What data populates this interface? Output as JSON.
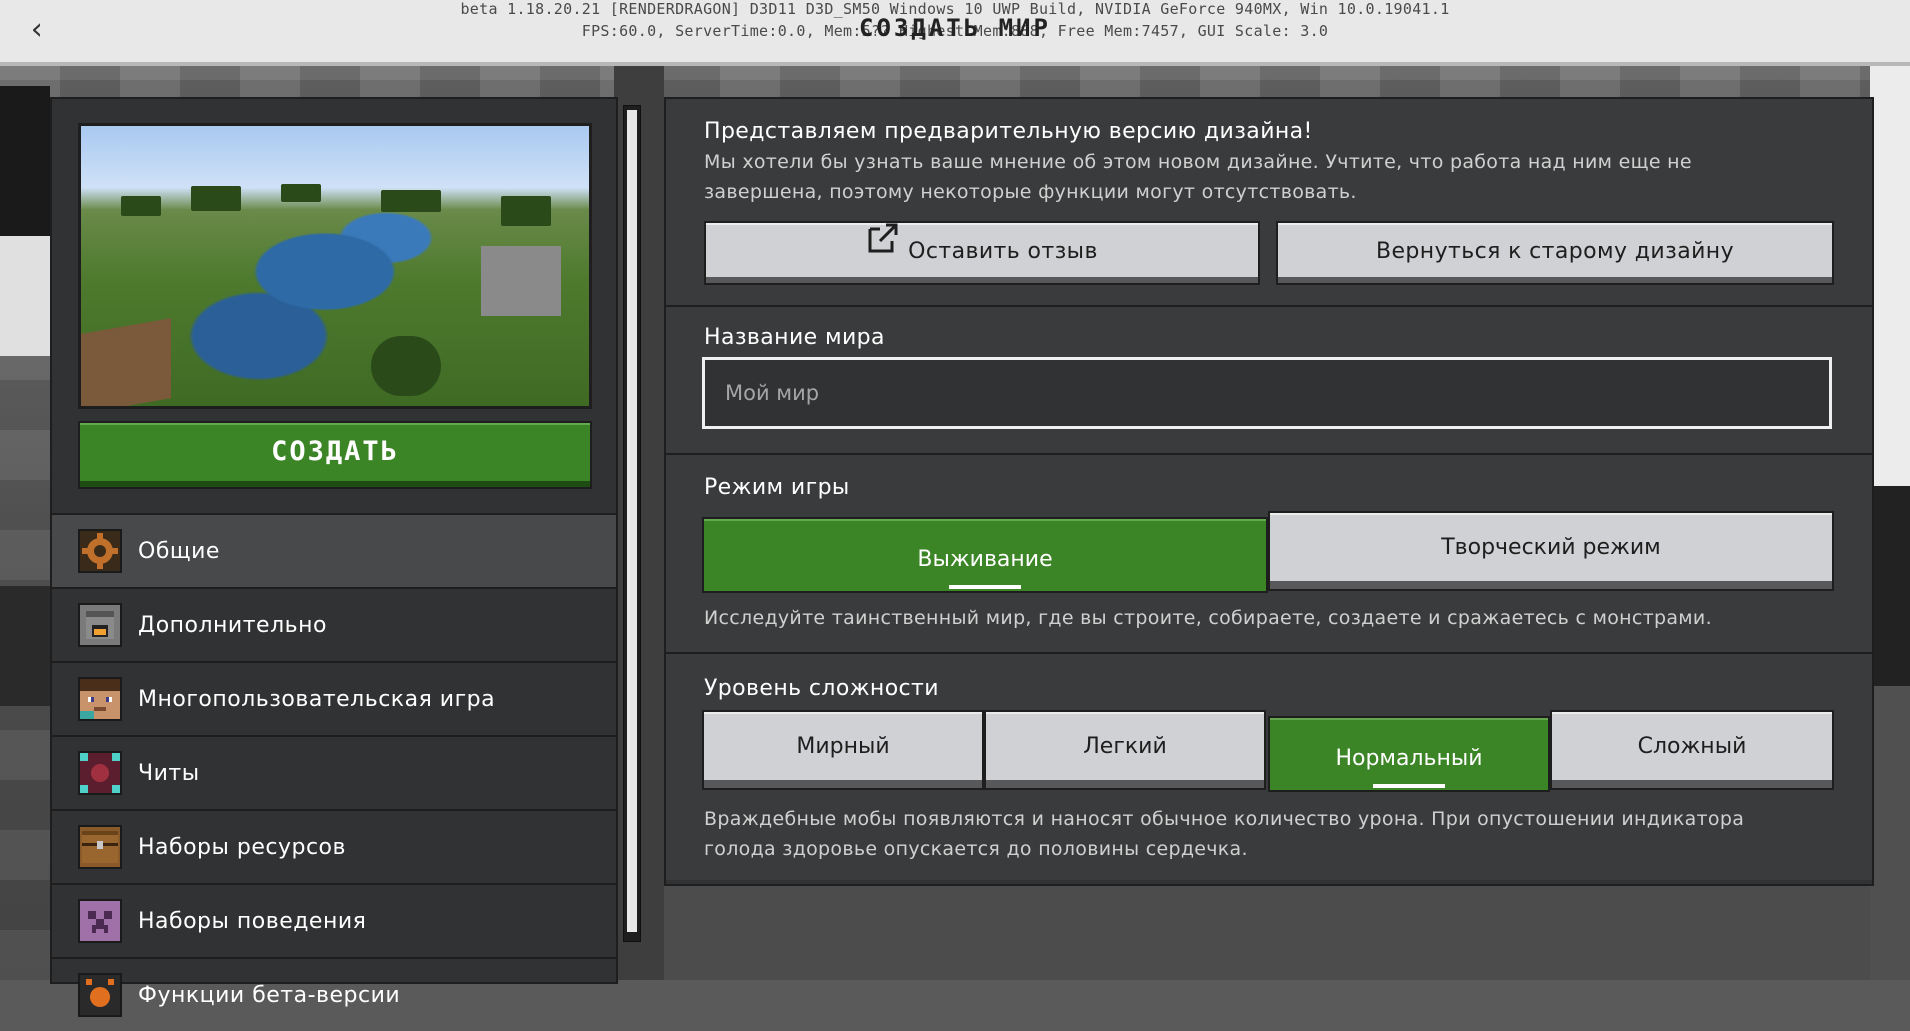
{
  "topbar": {
    "debug_line1": "beta 1.18.20.21 [RENDERDRAGON] D3D11 D3D_SM50 Windows 10 UWP Build, NVIDIA GeForce 940MX, Win 10.0.19041.1",
    "debug_line2": "FPS:60.0, ServerTime:0.0, Mem:5?? Highest Mem:888, Free Mem:7457, GUI Scale: 3.0",
    "title": "СОЗДАТЬ МИР",
    "back_icon": "chevron-left-icon"
  },
  "left": {
    "create_label": "СОЗДАТЬ",
    "nav": [
      {
        "label": "Общие",
        "icon": "gear-icon",
        "active": true
      },
      {
        "label": "Дополнительно",
        "icon": "furnace-icon",
        "active": false
      },
      {
        "label": "Многопользовательская игра",
        "icon": "steve-icon",
        "active": false
      },
      {
        "label": "Читы",
        "icon": "command-block-icon",
        "active": false
      },
      {
        "label": "Наборы ресурсов",
        "icon": "chest-icon",
        "active": false
      },
      {
        "label": "Наборы поведения",
        "icon": "creeper-icon",
        "active": false
      },
      {
        "label": "Функции бета-версии",
        "icon": "beta-icon",
        "active": false
      }
    ]
  },
  "preview": {
    "intro_title": "Представляем предварительную версию дизайна!",
    "intro_text_1": "Мы хотели бы узнать ваше мнение об этом новом дизайне. Учтите, что работа над ним еще не",
    "intro_text_2": "завершена, поэтому некоторые функции могут отсутствовать.",
    "feedback_label": "Оставить отзыв",
    "old_design_label": "Вернуться к старому дизайну"
  },
  "world_name": {
    "heading": "Название мира",
    "value": "Мой мир"
  },
  "game_mode": {
    "heading": "Режим игры",
    "survival_label": "Выживание",
    "creative_label": "Творческий режим",
    "selected": "Выживание",
    "description": "Исследуйте таинственный мир, где вы строите, собираете, создаете и сражаетесь с монстрами."
  },
  "difficulty": {
    "heading": "Уровень сложности",
    "options": [
      "Мирный",
      "Легкий",
      "Нормальный",
      "Сложный"
    ],
    "selected": "Нормальный",
    "description_1": "Враждебные мобы появляются и наносят обычное количество урона. При опустошении индикатора",
    "description_2": "голода здоровье опускается до половины сердечка."
  },
  "colors": {
    "green": "#3c8527",
    "panel": "#313233",
    "light_button": "#d0d1d4"
  }
}
